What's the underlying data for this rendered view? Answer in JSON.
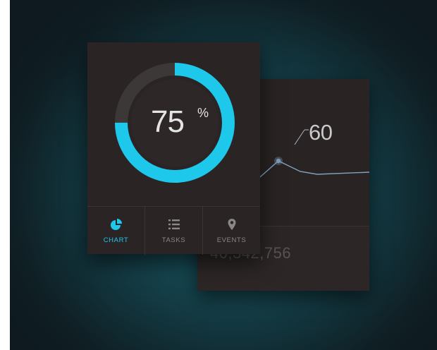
{
  "gauge": {
    "value_number": "75",
    "value_unit": "%",
    "fraction": 0.75,
    "accent_color": "#1ec8ea",
    "track_color": "#3d3838"
  },
  "line_card": {
    "peak_label": "60",
    "line_color": "#7fa3be",
    "point_color": "#7a9cb8",
    "total": "40,342,756"
  },
  "nav": {
    "items": [
      {
        "label": "CHART",
        "icon": "pie-chart-icon",
        "active": true
      },
      {
        "label": "TASKS",
        "icon": "list-icon",
        "active": false
      },
      {
        "label": "EVENTS",
        "icon": "location-pin-icon",
        "active": false
      }
    ]
  }
}
